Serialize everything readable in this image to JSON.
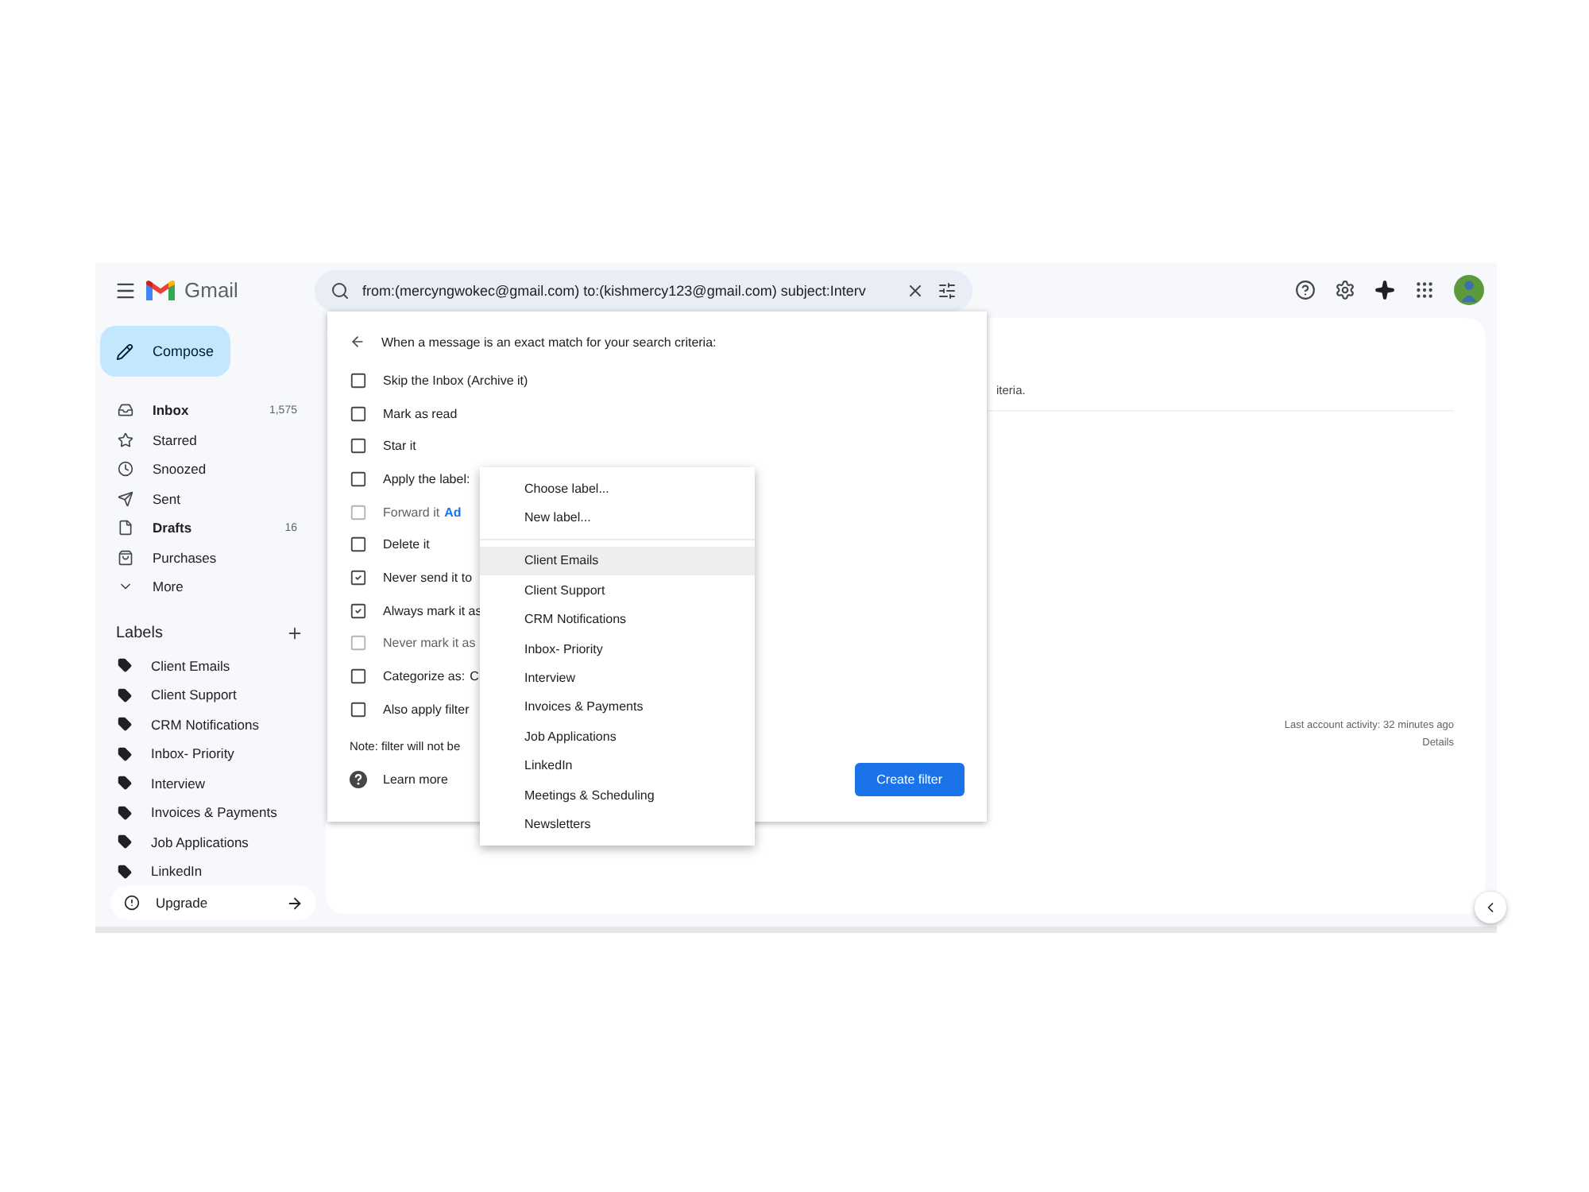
{
  "app": {
    "name": "Gmail"
  },
  "search": {
    "value": "from:(mercyngwokec@gmail.com) to:(kishmercy123@gmail.com) subject:Interv"
  },
  "compose": "Compose",
  "nav": [
    {
      "label": "Inbox",
      "count": "1,575",
      "bold": true
    },
    {
      "label": "Starred",
      "bold": false
    },
    {
      "label": "Snoozed",
      "bold": false
    },
    {
      "label": "Sent",
      "bold": false
    },
    {
      "label": "Drafts",
      "count": "16",
      "bold": true
    },
    {
      "label": "Purchases",
      "bold": false
    },
    {
      "label": "More",
      "bold": false
    }
  ],
  "labels_heading": "Labels",
  "labels": [
    "Client Emails",
    "Client Support",
    "CRM Notifications",
    "Inbox- Priority",
    "Interview",
    "Invoices & Payments",
    "Job Applications",
    "LinkedIn"
  ],
  "upgrade": "Upgrade",
  "main": {
    "behind_text": "iteria.",
    "activity": "Last account activity: 32 minutes ago",
    "details": "Details"
  },
  "filter": {
    "heading": "When a message is an exact match for your search criteria:",
    "options": [
      {
        "label": "Skip the Inbox (Archive it)",
        "checked": false,
        "disabled": false
      },
      {
        "label": "Mark as read",
        "checked": false,
        "disabled": false
      },
      {
        "label": "Star it",
        "checked": false,
        "disabled": false
      },
      {
        "label": "Apply the label:",
        "checked": false,
        "disabled": false
      },
      {
        "label": "Forward it",
        "checked": false,
        "disabled": true,
        "extra": {
          "text": "Ad",
          "kind": "link"
        }
      },
      {
        "label": "Delete it",
        "checked": false,
        "disabled": false
      },
      {
        "label": "Never send it to",
        "checked": true,
        "disabled": false
      },
      {
        "label": "Always mark it as",
        "checked": true,
        "disabled": false
      },
      {
        "label": "Never mark it as",
        "checked": false,
        "disabled": true
      },
      {
        "label": "Categorize as:",
        "checked": false,
        "disabled": false,
        "extra": {
          "text": "C",
          "kind": "text"
        }
      },
      {
        "label": "Also apply filter",
        "checked": false,
        "disabled": false
      }
    ],
    "note": "Note: filter will not be",
    "learn_more": "Learn more",
    "button": "Create filter"
  },
  "label_menu": {
    "actions": [
      "Choose label...",
      "New label..."
    ],
    "items": [
      {
        "label": "Client Emails",
        "selected": true
      },
      {
        "label": "Client Support",
        "selected": false
      },
      {
        "label": "CRM Notifications",
        "selected": false
      },
      {
        "label": "Inbox- Priority",
        "selected": false
      },
      {
        "label": "Interview",
        "selected": false
      },
      {
        "label": "Invoices & Payments",
        "selected": false
      },
      {
        "label": "Job Applications",
        "selected": false
      },
      {
        "label": "LinkedIn",
        "selected": false
      },
      {
        "label": "Meetings & Scheduling",
        "selected": false
      },
      {
        "label": "Newsletters",
        "selected": false
      }
    ]
  }
}
